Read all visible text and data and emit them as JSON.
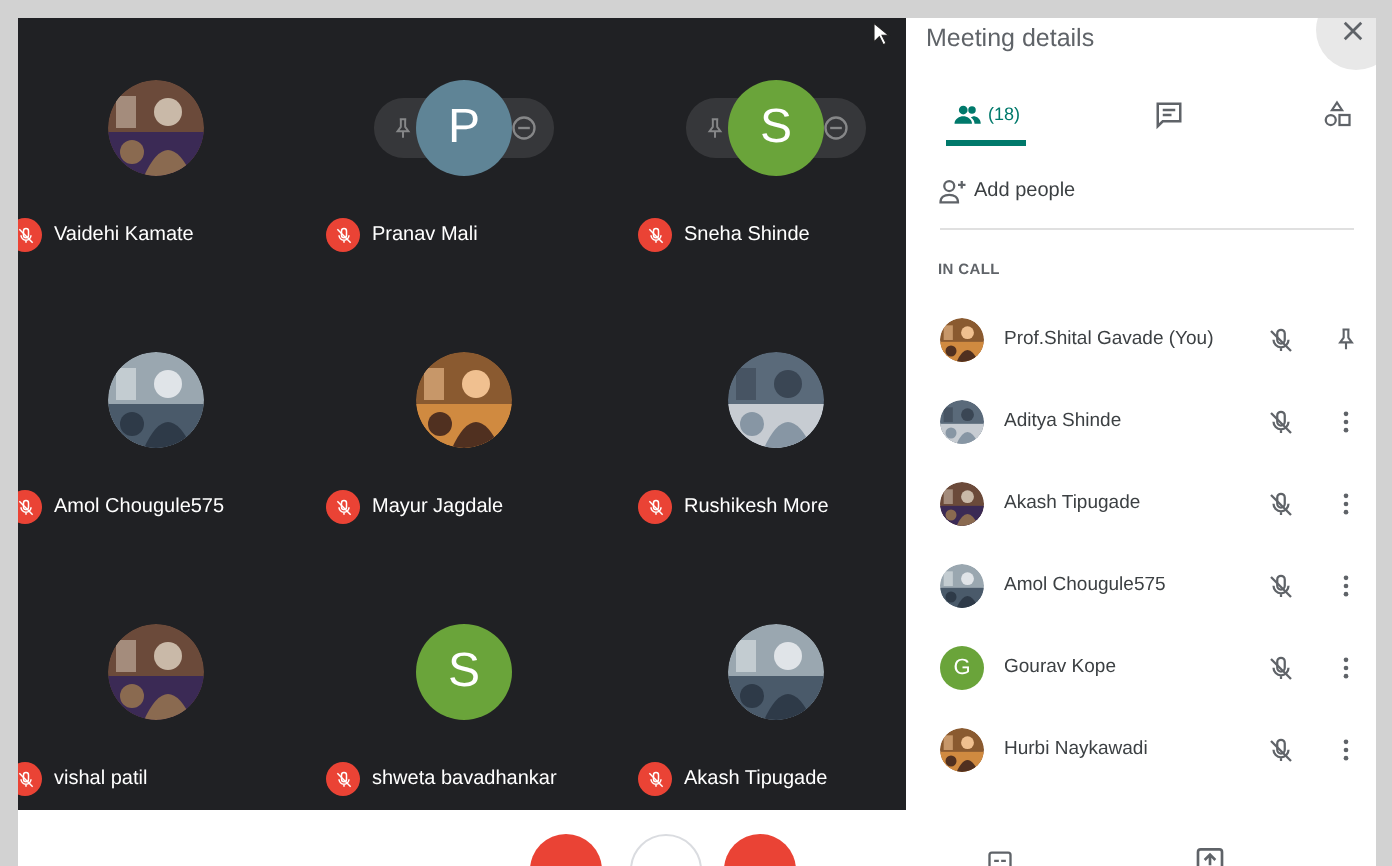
{
  "tiles": [
    {
      "name": "Vaidehi Kamate",
      "hover_controls": false
    },
    {
      "name": "Pranav Mali",
      "avatar": {
        "kind": "letter",
        "letter": "P",
        "color": "#5f8496"
      },
      "hover_controls": true
    },
    {
      "name": "Sneha Shinde",
      "avatar": {
        "kind": "letter",
        "letter": "S",
        "color": "#6aa43a"
      },
      "hover_controls": true
    },
    {
      "name": "Amol Chougule575",
      "hover_controls": false
    },
    {
      "name": "Mayur Jagdale",
      "hover_controls": false
    },
    {
      "name": "Rushikesh More",
      "hover_controls": false
    },
    {
      "name": "vishal patil",
      "hover_controls": false
    },
    {
      "name": "shweta bavadhankar",
      "avatar": {
        "kind": "letter",
        "letter": "S",
        "color": "#6aa43a"
      },
      "hover_controls": false
    },
    {
      "name": "Akash Tipugade",
      "hover_controls": false
    }
  ],
  "panel": {
    "title": "Meeting details",
    "tabs": [
      {
        "kind": "people",
        "label": "(18)",
        "selected": true
      },
      {
        "kind": "chat",
        "selected": false
      },
      {
        "kind": "activities",
        "selected": false
      }
    ],
    "add_people": "Add people",
    "section": "IN CALL",
    "participants": [
      {
        "name": "Prof.Shital Gavade (You)",
        "kind": "pin"
      },
      {
        "name": "Aditya Shinde",
        "kind": "more"
      },
      {
        "name": "Akash Tipugade",
        "kind": "more"
      },
      {
        "name": "Amol Chougule575",
        "kind": "more"
      },
      {
        "name": "Gourav Kope",
        "avatar": {
          "kind": "letter",
          "letter": "G",
          "color": "#6aa43a"
        },
        "kind": "more"
      },
      {
        "name": "Hurbi Naykawadi",
        "kind": "more"
      }
    ]
  },
  "controls": [
    {
      "kind": "danger"
    },
    {
      "kind": "plain"
    },
    {
      "kind": "danger"
    }
  ]
}
